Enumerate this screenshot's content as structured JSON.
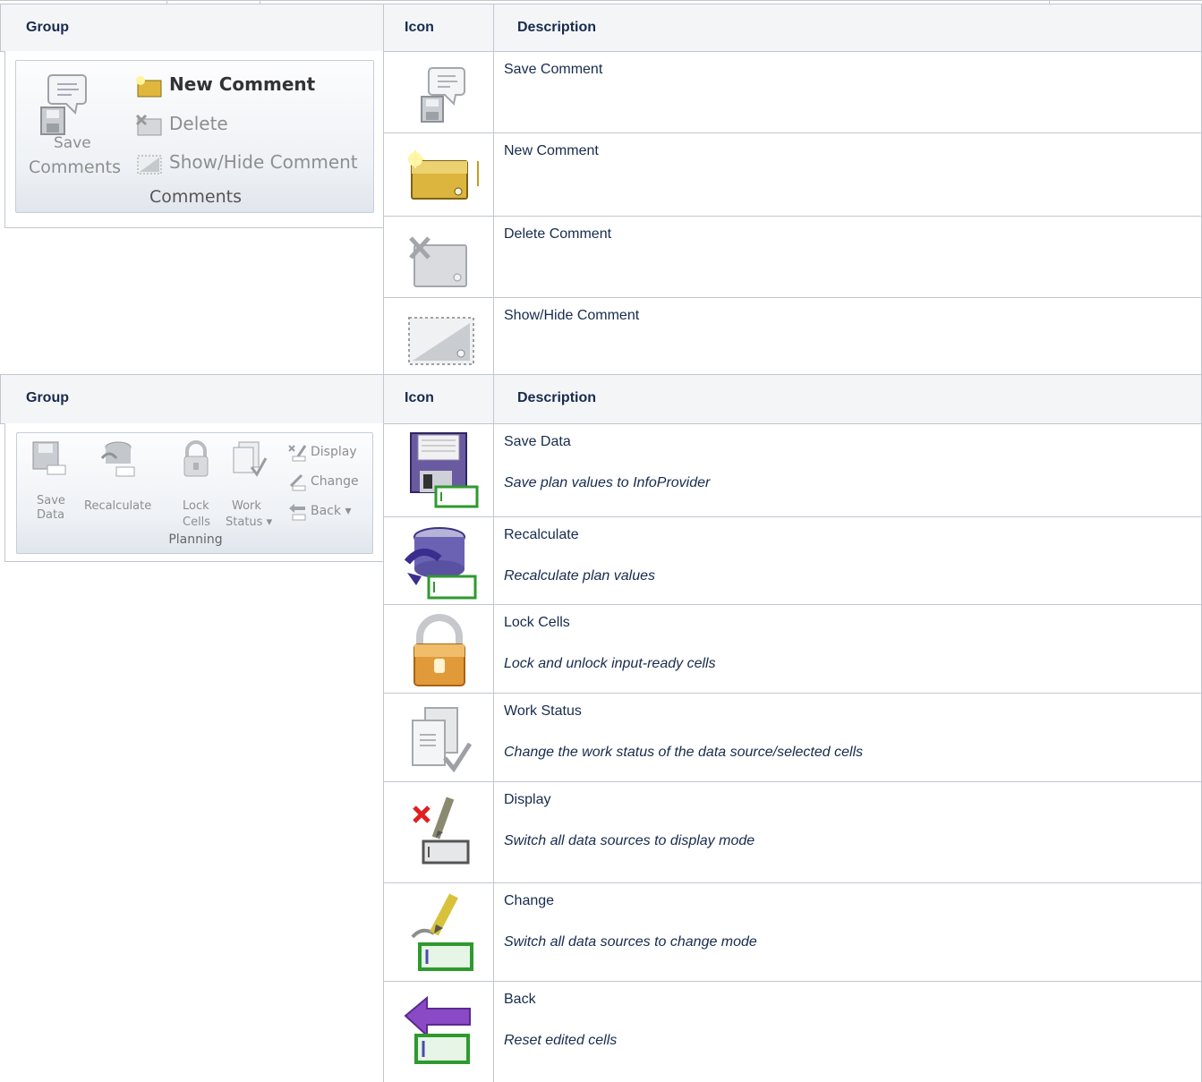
{
  "tables": [
    {
      "header": {
        "group": "Group",
        "icon": "Icon",
        "description": "Description"
      },
      "ribbon": {
        "new_comment": "New Comment",
        "delete": "Delete",
        "save_line1": "Save",
        "save_line2": "Comments",
        "show_hide": "Show/Hide Comment",
        "group_label": "Comments"
      },
      "rows": [
        {
          "icon": "save-comment-icon",
          "title": "Save Comment"
        },
        {
          "icon": "new-comment-icon",
          "title": "New Comment"
        },
        {
          "icon": "delete-comment-icon",
          "title": "Delete Comment"
        },
        {
          "icon": "show-hide-comment-icon",
          "title": "Show/Hide Comment"
        }
      ]
    },
    {
      "header": {
        "group": "Group",
        "icon": "Icon",
        "description": "Description"
      },
      "ribbon": {
        "save_line1": "Save",
        "save_line2": "Data",
        "recalculate": "Recalculate",
        "lock_line1": "Lock",
        "lock_line2": "Cells",
        "work_line1": "Work",
        "work_line2": "Status",
        "display": "Display",
        "change": "Change",
        "back": "Back",
        "group_label": "Planning"
      },
      "rows": [
        {
          "icon": "save-data-icon",
          "title": "Save Data",
          "subtitle": "Save plan values to InfoProvider"
        },
        {
          "icon": "recalculate-icon",
          "title": "Recalculate",
          "subtitle": "Recalculate plan values"
        },
        {
          "icon": "lock-cells-icon",
          "title": "Lock Cells",
          "subtitle": "Lock and unlock input-ready cells"
        },
        {
          "icon": "work-status-icon",
          "title": "Work Status",
          "subtitle": "Change the work status of the data source/selected cells"
        },
        {
          "icon": "display-icon",
          "title": "Display",
          "subtitle": "Switch all data sources to display mode"
        },
        {
          "icon": "change-icon",
          "title": "Change",
          "subtitle": "Switch all data sources to change mode"
        },
        {
          "icon": "back-icon",
          "title": "Back",
          "subtitle": "Reset edited cells"
        }
      ]
    }
  ]
}
